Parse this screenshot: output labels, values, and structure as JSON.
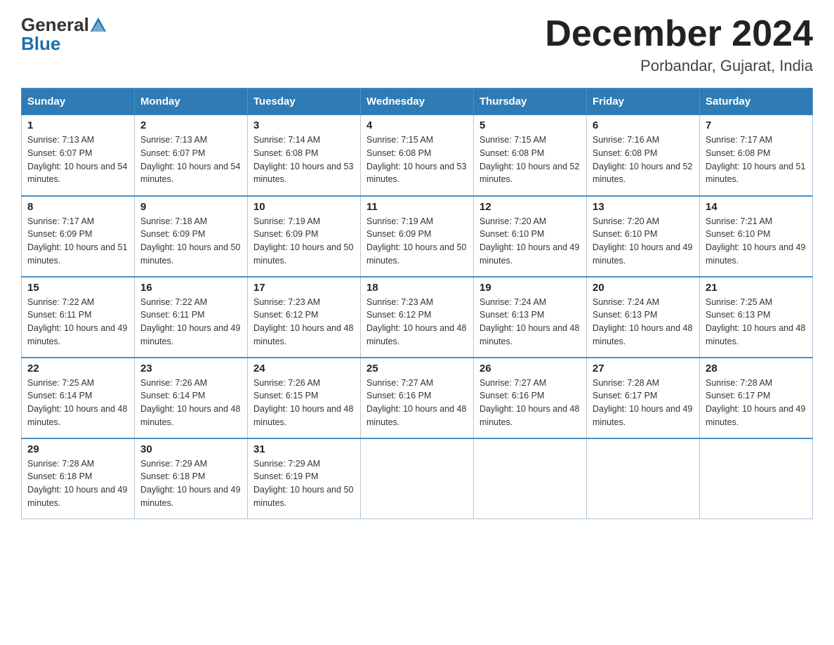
{
  "header": {
    "logo_general": "General",
    "logo_blue": "Blue",
    "month_year": "December 2024",
    "location": "Porbandar, Gujarat, India"
  },
  "columns": [
    "Sunday",
    "Monday",
    "Tuesday",
    "Wednesday",
    "Thursday",
    "Friday",
    "Saturday"
  ],
  "weeks": [
    [
      {
        "day": "1",
        "sunrise": "Sunrise: 7:13 AM",
        "sunset": "Sunset: 6:07 PM",
        "daylight": "Daylight: 10 hours and 54 minutes."
      },
      {
        "day": "2",
        "sunrise": "Sunrise: 7:13 AM",
        "sunset": "Sunset: 6:07 PM",
        "daylight": "Daylight: 10 hours and 54 minutes."
      },
      {
        "day": "3",
        "sunrise": "Sunrise: 7:14 AM",
        "sunset": "Sunset: 6:08 PM",
        "daylight": "Daylight: 10 hours and 53 minutes."
      },
      {
        "day": "4",
        "sunrise": "Sunrise: 7:15 AM",
        "sunset": "Sunset: 6:08 PM",
        "daylight": "Daylight: 10 hours and 53 minutes."
      },
      {
        "day": "5",
        "sunrise": "Sunrise: 7:15 AM",
        "sunset": "Sunset: 6:08 PM",
        "daylight": "Daylight: 10 hours and 52 minutes."
      },
      {
        "day": "6",
        "sunrise": "Sunrise: 7:16 AM",
        "sunset": "Sunset: 6:08 PM",
        "daylight": "Daylight: 10 hours and 52 minutes."
      },
      {
        "day": "7",
        "sunrise": "Sunrise: 7:17 AM",
        "sunset": "Sunset: 6:08 PM",
        "daylight": "Daylight: 10 hours and 51 minutes."
      }
    ],
    [
      {
        "day": "8",
        "sunrise": "Sunrise: 7:17 AM",
        "sunset": "Sunset: 6:09 PM",
        "daylight": "Daylight: 10 hours and 51 minutes."
      },
      {
        "day": "9",
        "sunrise": "Sunrise: 7:18 AM",
        "sunset": "Sunset: 6:09 PM",
        "daylight": "Daylight: 10 hours and 50 minutes."
      },
      {
        "day": "10",
        "sunrise": "Sunrise: 7:19 AM",
        "sunset": "Sunset: 6:09 PM",
        "daylight": "Daylight: 10 hours and 50 minutes."
      },
      {
        "day": "11",
        "sunrise": "Sunrise: 7:19 AM",
        "sunset": "Sunset: 6:09 PM",
        "daylight": "Daylight: 10 hours and 50 minutes."
      },
      {
        "day": "12",
        "sunrise": "Sunrise: 7:20 AM",
        "sunset": "Sunset: 6:10 PM",
        "daylight": "Daylight: 10 hours and 49 minutes."
      },
      {
        "day": "13",
        "sunrise": "Sunrise: 7:20 AM",
        "sunset": "Sunset: 6:10 PM",
        "daylight": "Daylight: 10 hours and 49 minutes."
      },
      {
        "day": "14",
        "sunrise": "Sunrise: 7:21 AM",
        "sunset": "Sunset: 6:10 PM",
        "daylight": "Daylight: 10 hours and 49 minutes."
      }
    ],
    [
      {
        "day": "15",
        "sunrise": "Sunrise: 7:22 AM",
        "sunset": "Sunset: 6:11 PM",
        "daylight": "Daylight: 10 hours and 49 minutes."
      },
      {
        "day": "16",
        "sunrise": "Sunrise: 7:22 AM",
        "sunset": "Sunset: 6:11 PM",
        "daylight": "Daylight: 10 hours and 49 minutes."
      },
      {
        "day": "17",
        "sunrise": "Sunrise: 7:23 AM",
        "sunset": "Sunset: 6:12 PM",
        "daylight": "Daylight: 10 hours and 48 minutes."
      },
      {
        "day": "18",
        "sunrise": "Sunrise: 7:23 AM",
        "sunset": "Sunset: 6:12 PM",
        "daylight": "Daylight: 10 hours and 48 minutes."
      },
      {
        "day": "19",
        "sunrise": "Sunrise: 7:24 AM",
        "sunset": "Sunset: 6:13 PM",
        "daylight": "Daylight: 10 hours and 48 minutes."
      },
      {
        "day": "20",
        "sunrise": "Sunrise: 7:24 AM",
        "sunset": "Sunset: 6:13 PM",
        "daylight": "Daylight: 10 hours and 48 minutes."
      },
      {
        "day": "21",
        "sunrise": "Sunrise: 7:25 AM",
        "sunset": "Sunset: 6:13 PM",
        "daylight": "Daylight: 10 hours and 48 minutes."
      }
    ],
    [
      {
        "day": "22",
        "sunrise": "Sunrise: 7:25 AM",
        "sunset": "Sunset: 6:14 PM",
        "daylight": "Daylight: 10 hours and 48 minutes."
      },
      {
        "day": "23",
        "sunrise": "Sunrise: 7:26 AM",
        "sunset": "Sunset: 6:14 PM",
        "daylight": "Daylight: 10 hours and 48 minutes."
      },
      {
        "day": "24",
        "sunrise": "Sunrise: 7:26 AM",
        "sunset": "Sunset: 6:15 PM",
        "daylight": "Daylight: 10 hours and 48 minutes."
      },
      {
        "day": "25",
        "sunrise": "Sunrise: 7:27 AM",
        "sunset": "Sunset: 6:16 PM",
        "daylight": "Daylight: 10 hours and 48 minutes."
      },
      {
        "day": "26",
        "sunrise": "Sunrise: 7:27 AM",
        "sunset": "Sunset: 6:16 PM",
        "daylight": "Daylight: 10 hours and 48 minutes."
      },
      {
        "day": "27",
        "sunrise": "Sunrise: 7:28 AM",
        "sunset": "Sunset: 6:17 PM",
        "daylight": "Daylight: 10 hours and 49 minutes."
      },
      {
        "day": "28",
        "sunrise": "Sunrise: 7:28 AM",
        "sunset": "Sunset: 6:17 PM",
        "daylight": "Daylight: 10 hours and 49 minutes."
      }
    ],
    [
      {
        "day": "29",
        "sunrise": "Sunrise: 7:28 AM",
        "sunset": "Sunset: 6:18 PM",
        "daylight": "Daylight: 10 hours and 49 minutes."
      },
      {
        "day": "30",
        "sunrise": "Sunrise: 7:29 AM",
        "sunset": "Sunset: 6:18 PM",
        "daylight": "Daylight: 10 hours and 49 minutes."
      },
      {
        "day": "31",
        "sunrise": "Sunrise: 7:29 AM",
        "sunset": "Sunset: 6:19 PM",
        "daylight": "Daylight: 10 hours and 50 minutes."
      },
      null,
      null,
      null,
      null
    ]
  ]
}
